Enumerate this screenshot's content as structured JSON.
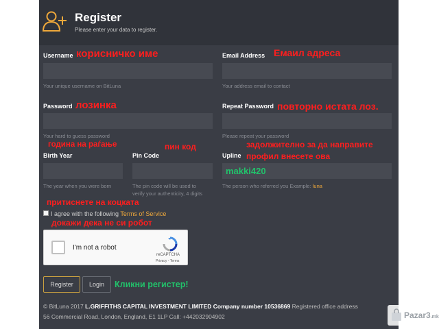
{
  "header": {
    "title": "Register",
    "subtitle": "Please enter your data to register."
  },
  "form": {
    "username": {
      "label": "Username",
      "value": "",
      "hint": "Your unique username on BitLuna",
      "annotation": "корисничко име"
    },
    "email": {
      "label": "Email Address",
      "value": "",
      "hint": "Your address email to contact",
      "annotation": "Емаил адреса"
    },
    "password": {
      "label": "Password",
      "value": "",
      "hint": "Your hard to guess password",
      "annotation": "лозинка"
    },
    "repeat_password": {
      "label": "Repeat Password",
      "value": "",
      "hint": "Please repeat your password",
      "annotation": "повторно истата лоз."
    },
    "birth_year": {
      "label": "Birth Year",
      "value": "",
      "hint": "The year when you were born",
      "annotation": "година на раѓање"
    },
    "pin_code": {
      "label": "Pin Code",
      "value": "",
      "hint_line1": "The pin code will be used to",
      "hint_line2": "verify your authenticity, 4 digits",
      "annotation": "пин код"
    },
    "upline": {
      "label": "Upline",
      "value": "makki420",
      "hint": "The person who referred you Example:",
      "hint_example": "luna",
      "annotation_line1": "задолжително за да направите",
      "annotation_line2": "профил внесете ова"
    },
    "terms": {
      "prefix": "I agree with the following",
      "link": "Terms of Service",
      "checked": false,
      "annotation": "притиснете на коцката"
    },
    "captcha": {
      "label": "I'm not a robot",
      "brand": "reCAPTCHA",
      "links": "Privacy - Terms",
      "annotation": "докажи дека не си робот"
    }
  },
  "buttons": {
    "register": "Register",
    "login": "Login",
    "annotation": "Кликни регистер!"
  },
  "footer": {
    "copyright": "© BitLuna 2017",
    "company": "L.GRIFFITHS CAPITAL INVESTMENT LIMITED Company number 10536869",
    "office": "Registered office address",
    "address": "56 Commercial Road, London, England, E1 1LP Call: +442032904902"
  },
  "watermark": {
    "text": "Pazar3",
    "suffix": ".mk"
  },
  "colors": {
    "panel": "#3a3d45",
    "header": "#30333a",
    "input": "#474a52",
    "accent": "#f0a93b",
    "annotation_red": "#ff1e1e",
    "annotation_green": "#22c26b"
  }
}
